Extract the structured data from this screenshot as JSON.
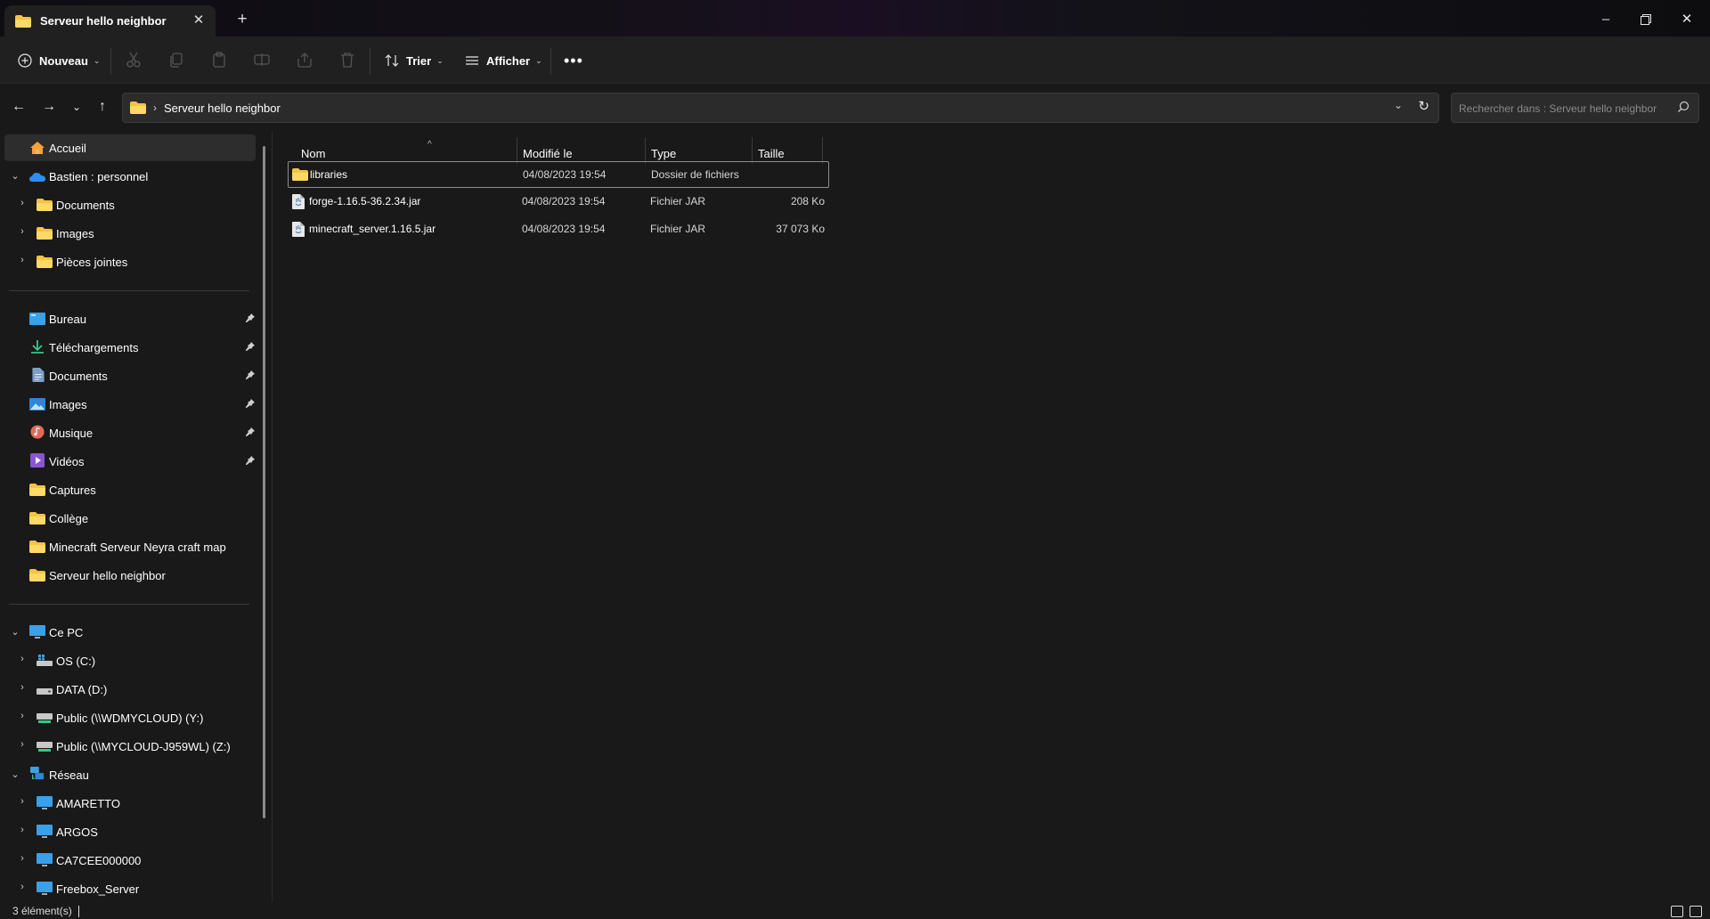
{
  "window": {
    "tab_title": "Serveur hello neighbor",
    "controls": [
      "minimize-icon",
      "restore-icon",
      "close-icon"
    ]
  },
  "toolbar": {
    "new_label": "Nouveau",
    "sort_label": "Trier",
    "view_label": "Afficher",
    "icons": [
      "cut-icon",
      "copy-icon",
      "paste-icon",
      "rename-icon",
      "share-icon",
      "delete-icon",
      "more-icon"
    ]
  },
  "address": {
    "crumb": "Serveur hello neighbor"
  },
  "search": {
    "placeholder": "Rechercher dans : Serveur hello neighbor"
  },
  "sidebar": {
    "home": "Accueil",
    "onedrive": "Bastien : personnel",
    "onedrive_children": [
      "Documents",
      "Images",
      "Pièces jointes"
    ],
    "quick_access": [
      {
        "label": "Bureau",
        "icon": "desktop-icon",
        "pinned": true
      },
      {
        "label": "Téléchargements",
        "icon": "download-icon",
        "pinned": true
      },
      {
        "label": "Documents",
        "icon": "document-icon",
        "pinned": true
      },
      {
        "label": "Images",
        "icon": "picture-icon",
        "pinned": true
      },
      {
        "label": "Musique",
        "icon": "music-icon",
        "pinned": true
      },
      {
        "label": "Vidéos",
        "icon": "video-icon",
        "pinned": true
      },
      {
        "label": "Captures",
        "icon": "folder-icon",
        "pinned": false
      },
      {
        "label": "Collège",
        "icon": "folder-icon",
        "pinned": false
      },
      {
        "label": "Minecraft Serveur Neyra craft map",
        "icon": "folder-icon",
        "pinned": false
      },
      {
        "label": "Serveur hello neighbor",
        "icon": "folder-icon",
        "pinned": false
      }
    ],
    "this_pc": "Ce PC",
    "drives": [
      "OS (C:)",
      "DATA (D:)",
      "Public (\\\\WDMYCLOUD) (Y:)",
      "Public (\\\\MYCLOUD-J959WL) (Z:)"
    ],
    "network": "Réseau",
    "network_items": [
      "AMARETTO",
      "ARGOS",
      "CA7CEE000000",
      "Freebox_Server"
    ]
  },
  "filelist": {
    "columns": [
      "Nom",
      "Modifié le",
      "Type",
      "Taille"
    ],
    "rows": [
      {
        "name": "libraries",
        "modified": "04/08/2023 19:54",
        "type": "Dossier de fichiers",
        "size": "",
        "icon": "folder-icon"
      },
      {
        "name": "forge-1.16.5-36.2.34.jar",
        "modified": "04/08/2023 19:54",
        "type": "Fichier JAR",
        "size": "208 Ko",
        "icon": "jar-file-icon"
      },
      {
        "name": "minecraft_server.1.16.5.jar",
        "modified": "04/08/2023 19:54",
        "type": "Fichier JAR",
        "size": "37 073 Ko",
        "icon": "jar-file-icon"
      }
    ]
  },
  "status": {
    "count": "3 élément(s)"
  },
  "colors": {
    "background": "#191919",
    "toolbar": "#202020",
    "folder": "#f4c343",
    "onedrive": "#2c8ff0"
  }
}
